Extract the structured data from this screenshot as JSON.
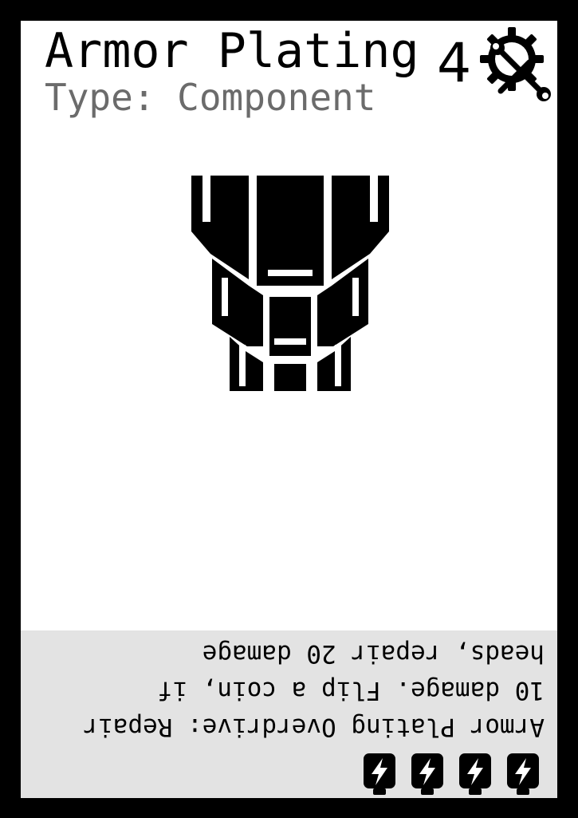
{
  "card": {
    "title": "Armor Plating",
    "type_line": "Type: Component",
    "cost": "4",
    "cost_icon": "gear-wrench-icon",
    "art_icon": "armor-plating-icon",
    "ability_text": "Armor Plating Overdrive: Repair\n10 damage. Flip a coin, if\nheads, repair 20 damage",
    "ability_text_orientation": "upside-down",
    "energy_cost": 4,
    "energy_icon": "lightning-battery-icon",
    "colors": {
      "border": "#000000",
      "card_bg": "#ffffff",
      "type_text": "#6b6b6b",
      "ability_bg": "#e3e3e3"
    }
  }
}
